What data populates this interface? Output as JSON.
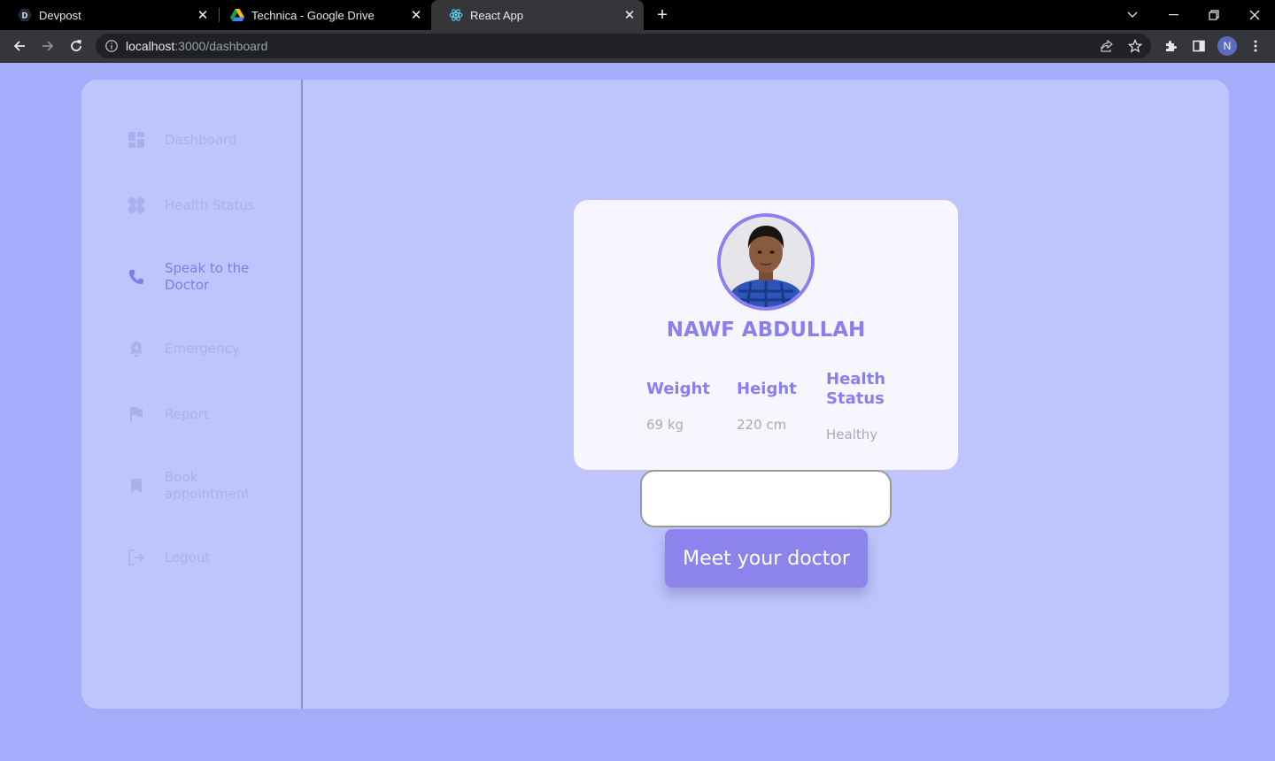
{
  "browser": {
    "tabs": [
      {
        "title": "Devpost",
        "favicon": "devpost-icon"
      },
      {
        "title": "Technica - Google Drive",
        "favicon": "google-drive-icon"
      },
      {
        "title": "React App",
        "favicon": "react-icon",
        "active": true
      }
    ],
    "url_host": "localhost",
    "url_path": ":3000/dashboard",
    "profile_initial": "N"
  },
  "sidebar": {
    "items": [
      {
        "label": "Dashboard",
        "icon": "dashboard-icon"
      },
      {
        "label": "Health Status",
        "icon": "bandage-icon"
      },
      {
        "label": "Speak to the Doctor",
        "icon": "phone-icon",
        "active": true
      },
      {
        "label": "Emergency",
        "icon": "alarm-bell-icon"
      },
      {
        "label": "Report",
        "icon": "flag-icon"
      },
      {
        "label": "Book appointment",
        "icon": "bookmark-icon"
      },
      {
        "label": "Logout",
        "icon": "logout-icon"
      }
    ]
  },
  "profile": {
    "name": "NAWF ABDULLAH",
    "stats": [
      {
        "label": "Weight",
        "value": "69 kg"
      },
      {
        "label": "Height",
        "value": "220 cm"
      },
      {
        "label": "Health Status",
        "value": "Healthy"
      }
    ]
  },
  "actions": {
    "input_value": "",
    "meet_button": "Meet your doctor"
  },
  "colors": {
    "page_bg": "#a3adfb",
    "panel_bg": "#bec5fd",
    "accent": "#8a7fef",
    "button": "#8c84ec"
  }
}
